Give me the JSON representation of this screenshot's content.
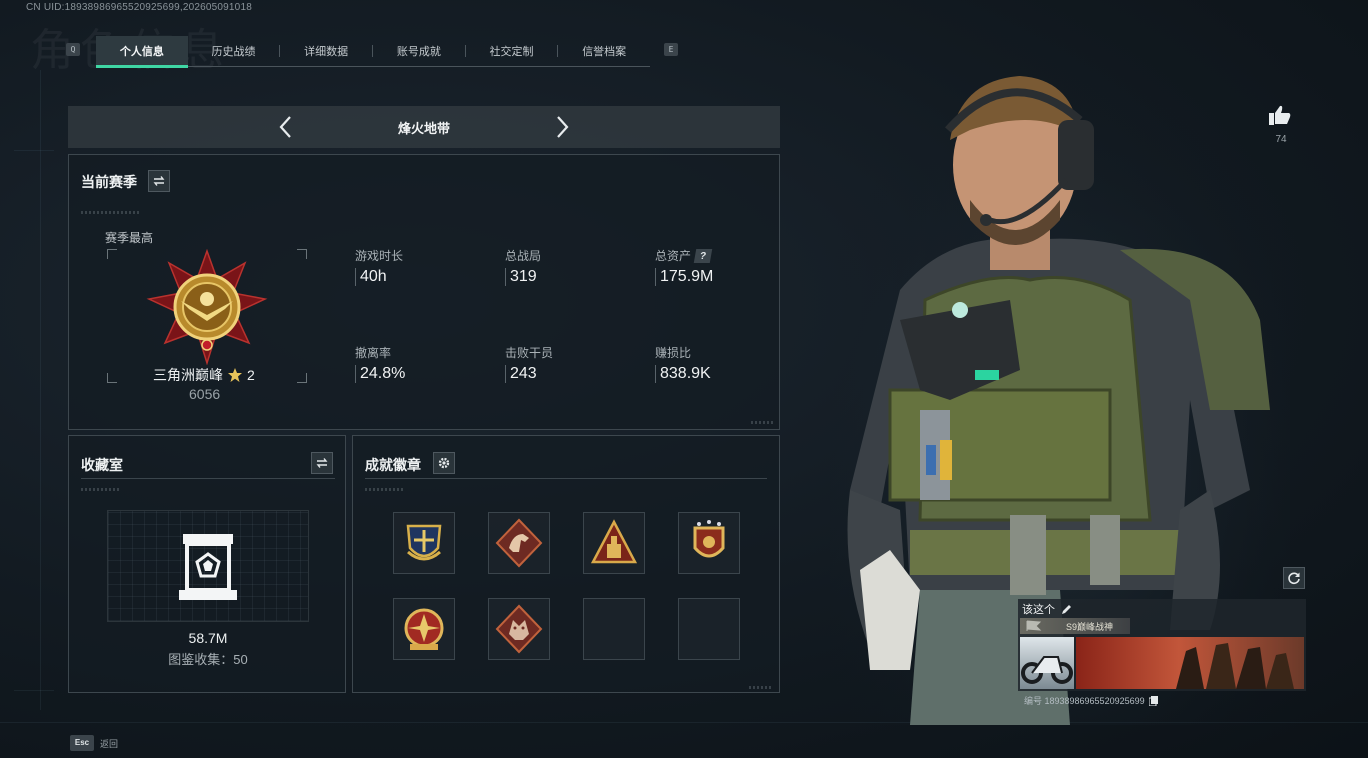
{
  "header": {
    "uid_line": "CN UID:18938986965520925699,202605091018",
    "watermark": "角色信息",
    "left_key": "Q",
    "right_key": "E"
  },
  "tabs": [
    {
      "label": "个人信息",
      "active": true
    },
    {
      "label": "历史战绩",
      "active": false
    },
    {
      "label": "详细数据",
      "active": false
    },
    {
      "label": "账号成就",
      "active": false
    },
    {
      "label": "社交定制",
      "active": false
    },
    {
      "label": "信誉档案",
      "active": false
    }
  ],
  "mode": {
    "title": "烽火地带"
  },
  "season": {
    "title": "当前赛季",
    "best_label": "赛季最高",
    "rank_name": "三角洲巅峰",
    "rank_stars": "2",
    "rank_points": "6056",
    "stats": [
      {
        "label": "游戏时长",
        "value": "40h"
      },
      {
        "label": "总战局",
        "value": "319"
      },
      {
        "label": "总资产",
        "value": "175.9M",
        "help": "?"
      },
      {
        "label": "撤离率",
        "value": "24.8%"
      },
      {
        "label": "击败干员",
        "value": "243"
      },
      {
        "label": "赚损比",
        "value": "838.9K"
      }
    ]
  },
  "collection": {
    "title": "收藏室",
    "value": "58.7M",
    "catalog_label": "图鉴收集：",
    "catalog_count": "50"
  },
  "achievements": {
    "title": "成就徽章",
    "badges": [
      "shield-crest-badge",
      "horse-badge",
      "triangle-ammo-badge",
      "star-shield-badge",
      "compass-star-badge",
      "dragon-badge",
      "",
      ""
    ]
  },
  "likes": {
    "count": "74"
  },
  "player_card": {
    "name": "该这个",
    "title_tag": "S9巅峰战神",
    "id_line": "编号 18938986965520925699"
  },
  "footer": {
    "esc_key": "Esc",
    "back_label": "返回"
  },
  "colors": {
    "accent": "#3fd6a4",
    "panel_border": "#3d474e",
    "background": "#121a21"
  }
}
